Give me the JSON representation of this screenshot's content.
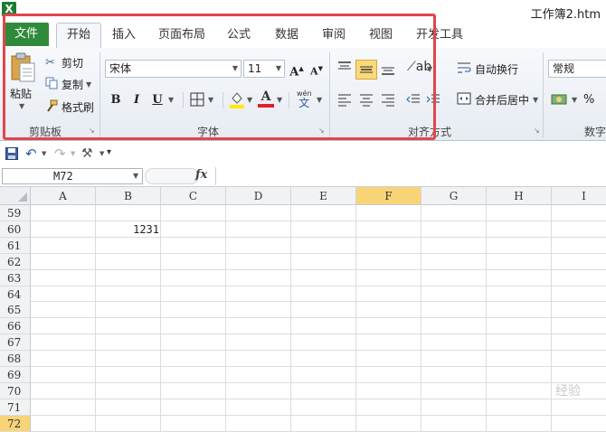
{
  "window": {
    "title": "工作簿2.htm",
    "app_icon": "X"
  },
  "tabs": [
    "文件",
    "开始",
    "插入",
    "页面布局",
    "公式",
    "数据",
    "审阅",
    "视图",
    "开发工具"
  ],
  "ribbon": {
    "clipboard": {
      "paste": "粘贴",
      "cut": "剪切",
      "copy": "复制",
      "format_painter": "格式刷",
      "label": "剪贴板"
    },
    "font": {
      "name": "宋体",
      "size": "11",
      "label": "字体",
      "bold": "B",
      "italic": "I",
      "underline": "U",
      "phonetic": "wén"
    },
    "alignment": {
      "wrap_text": "自动换行",
      "merge_center": "合并后居中",
      "label": "对齐方式"
    },
    "number": {
      "format": "常规",
      "label": "数字",
      "percent": "%"
    }
  },
  "formula_bar": {
    "name_box": "M72",
    "fx": "fx",
    "value": ""
  },
  "columns": [
    "A",
    "B",
    "C",
    "D",
    "E",
    "F",
    "G",
    "H",
    "I"
  ],
  "rows": [
    "59",
    "60",
    "61",
    "62",
    "63",
    "64",
    "65",
    "66",
    "67",
    "68",
    "69",
    "70",
    "71",
    "72"
  ],
  "cells": {
    "B60": "1231"
  },
  "active": {
    "row": "72",
    "column": "F"
  },
  "watermark": "经验",
  "colors": {
    "file_tab": "#2f8b3b",
    "highlight": "#e0464c",
    "active_header": "#f8d477"
  }
}
